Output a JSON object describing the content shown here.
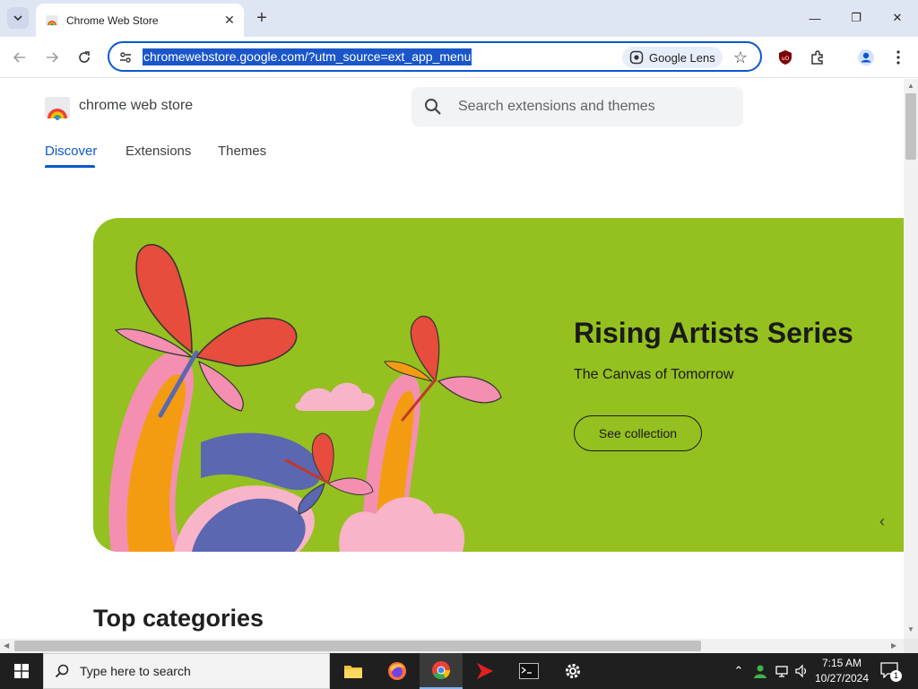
{
  "browser": {
    "tab": {
      "title": "Chrome Web Store",
      "close": "✕"
    },
    "new_tab": "+",
    "window": {
      "minimize": "—",
      "maximize": "❐",
      "close": "✕"
    },
    "omnibox": {
      "url": "chromewebstore.google.com/?utm_source=ext_app_menu",
      "lens_label": "Google Lens"
    }
  },
  "store": {
    "name": "chrome web store",
    "search_placeholder": "Search extensions and themes",
    "tabs": [
      "Discover",
      "Extensions",
      "Themes"
    ],
    "active_tab": "Discover",
    "hero": {
      "title": "Rising Artists Series",
      "subtitle": "The Canvas of Tomorrow",
      "button": "See collection",
      "background": "#94c11f"
    },
    "section_title": "Top categories"
  },
  "taskbar": {
    "search_placeholder": "Type here to search",
    "clock": {
      "time": "7:15 AM",
      "date": "10/27/2024"
    },
    "notification_count": "1"
  },
  "colors": {
    "accent": "#0b57d0",
    "tabstrip": "#dfe6f3",
    "url_highlight": "#1a56c9"
  },
  "icons": [
    "tab-search-icon",
    "chrome-web-store-icon",
    "back-icon",
    "forward-icon",
    "reload-icon",
    "site-info-icon",
    "google-lens-icon",
    "star-icon",
    "ublock-icon",
    "extensions-icon",
    "profile-icon",
    "menu-icon",
    "search-icon",
    "windows-start-icon",
    "file-explorer-icon",
    "firefox-icon",
    "chrome-icon",
    "app-icon",
    "terminal-icon",
    "settings-icon"
  ]
}
